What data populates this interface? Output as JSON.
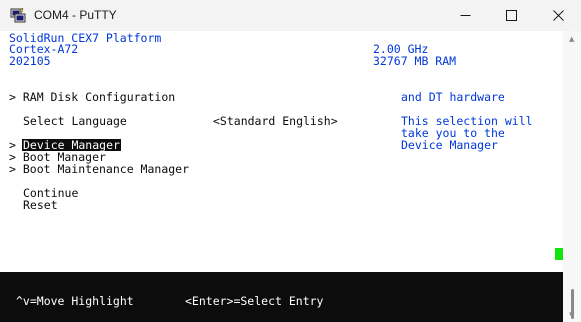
{
  "window": {
    "title": "COM4 - PuTTY"
  },
  "header": {
    "platform": "SolidRun CEX7 Platform",
    "cpu": "Cortex-A72",
    "version": "202105",
    "cpu_speed": "2.00 GHz",
    "memory": "32767 MB RAM"
  },
  "menu": {
    "ram_disk": "> RAM Disk Configuration",
    "select_language_label": "Select Language",
    "select_language_value": "<Standard English>",
    "device_manager_arrow": ">",
    "device_manager": "Device Manager",
    "boot_manager": "> Boot Manager",
    "boot_maintenance": "> Boot Maintenance Manager",
    "continue": "Continue",
    "reset": "Reset"
  },
  "help": {
    "dt_hardware": "and DT hardware",
    "line1": "This selection will",
    "line2": "take you to the",
    "line3": "Device Manager"
  },
  "status": {
    "move_highlight": "^v=Move Highlight",
    "select_entry": "<Enter>=Select Entry"
  },
  "colors": {
    "terminal_blue": "#0037da",
    "terminal_black": "#0c0c0c",
    "cursor_green": "#13e40c"
  },
  "icons": {
    "app": "putty-icon",
    "minimize": "minimize-icon",
    "maximize": "maximize-icon",
    "close": "close-icon"
  }
}
